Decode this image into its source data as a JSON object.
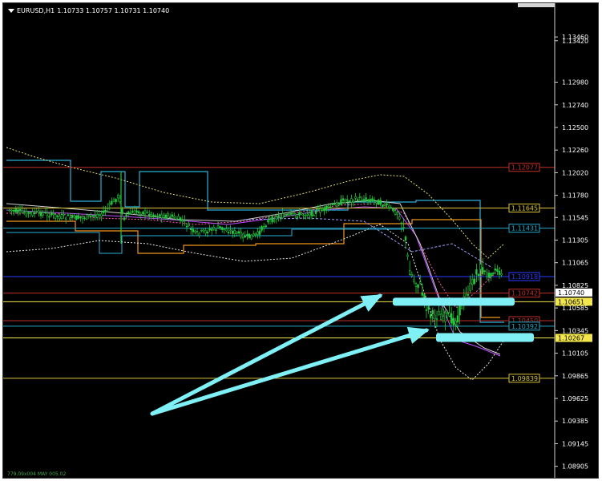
{
  "chart": {
    "symbol_timeframe": "EURUSD,H1",
    "ohlc": "1.10733 1.10757 1.10731 1.10740",
    "colors": {
      "background": "#000000",
      "axis_text": "#ffffff",
      "candles": "#22c93a",
      "arrows": "#7ff0f5"
    }
  },
  "price_axis": {
    "ymin": 1.088,
    "ymax": 1.1375,
    "ticks": [
      "1.13460",
      "1.13420",
      "1.12980",
      "1.12740",
      "1.12500",
      "1.12260",
      "1.12020",
      "1.11780",
      "1.11545",
      "1.11305",
      "1.11065",
      "1.10825",
      "1.10585",
      "1.10345",
      "1.10105",
      "1.09865",
      "1.09625",
      "1.09385",
      "1.09145",
      "1.08905"
    ],
    "current_price": {
      "label": "1.10740",
      "value": 1.1074
    }
  },
  "levels": [
    {
      "label": "1.12077",
      "value": 1.12077,
      "color": "#c0302a"
    },
    {
      "label": "1.11645",
      "value": 1.11645,
      "color": "#d8c23a"
    },
    {
      "label": "1.11431",
      "value": 1.11431,
      "color": "#24a8c8"
    },
    {
      "label": "1.10918",
      "value": 1.10918,
      "color": "#2a3cff"
    },
    {
      "label": "1.10742",
      "value": 1.10742,
      "color": "#c0302a"
    },
    {
      "label": "1.10651",
      "value": 1.10651,
      "color": "#f2e64a",
      "filled": true
    },
    {
      "label": "1.10450",
      "value": 1.1045,
      "color": "#c0302a"
    },
    {
      "label": "1.10392",
      "value": 1.10392,
      "color": "#24a8c8"
    },
    {
      "label": "1.10267",
      "value": 1.10267,
      "color": "#f2e64a",
      "filled": true
    },
    {
      "label": "1.09839",
      "value": 1.09839,
      "color": "#d8c23a"
    }
  ],
  "annotations": {
    "arrow_color": "#7ff0f5",
    "zones": [
      {
        "name": "upper-zone",
        "price": 1.10651
      },
      {
        "name": "lower-zone",
        "price": 1.10267
      }
    ]
  },
  "footer": {
    "note": "779.09x004 MAY 005.02"
  }
}
